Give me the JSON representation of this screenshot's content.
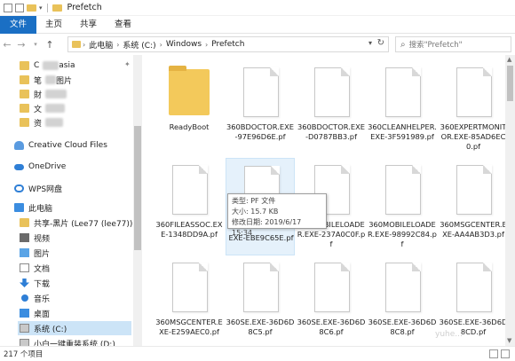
{
  "window": {
    "title": "Prefetch"
  },
  "ribbon": {
    "tabs": [
      "文件",
      "主页",
      "共享",
      "查看"
    ]
  },
  "address": {
    "crumbs": [
      "此电脑",
      "系统 (C:)",
      "Windows",
      "Prefetch"
    ],
    "search_placeholder": "搜索\"Prefetch\""
  },
  "nav": {
    "items": [
      {
        "label": "C",
        "trail": "asia"
      },
      {
        "label": "笔",
        "trail": "图片"
      },
      {
        "label": "財",
        "trail": ""
      },
      {
        "label": "文",
        "trail": ""
      },
      {
        "label": "资",
        "trail": ""
      },
      {
        "label": "Creative Cloud Files"
      },
      {
        "label": "OneDrive"
      },
      {
        "label": "WPS网盘"
      },
      {
        "label": "此电脑"
      },
      {
        "label": "共享-黑片 (Lee77 (lee77))"
      },
      {
        "label": "视频"
      },
      {
        "label": "图片"
      },
      {
        "label": "文档"
      },
      {
        "label": "下载"
      },
      {
        "label": "音乐"
      },
      {
        "label": "桌面"
      },
      {
        "label": "系统 (C:)"
      },
      {
        "label": "小白一键重装系统 (D:)"
      }
    ]
  },
  "files": [
    "ReadyBoot",
    "360BDOCTOR.EXE-97E96D6E.pf",
    "360BDOCTOR.EXE-D0787BB3.pf",
    "360CLEANHELPER.EXE-3F591989.pf",
    "360EXPERTMONITOR.EXE-85AD6EC0.pf",
    "360FILEASSOC.EXE-1348DD9A.pf",
    "EXE-EBE9C65E.pf",
    "360MOBILELOADER.EXE-237A0C0F.pf",
    "360MOBILELOADER.EXE-98992C84.pf",
    "360MSGCENTER.EXE-AA4AB3D3.pf",
    "360MSGCENTER.EXE-E259AEC0.pf",
    "360SE.EXE-36D6D8C5.pf",
    "360SE.EXE-36D6D8C6.pf",
    "360SE.EXE-36D6D8C8.pf",
    "360SE.EXE-36D6D8CD.pf"
  ],
  "tooltip": {
    "type": "类型: PF 文件",
    "size": "大小: 15.7 KB",
    "modified": "修改日期: 2019/6/17 15:34"
  },
  "status": {
    "count": "217 个项目"
  },
  "watermark": "yuhe..."
}
